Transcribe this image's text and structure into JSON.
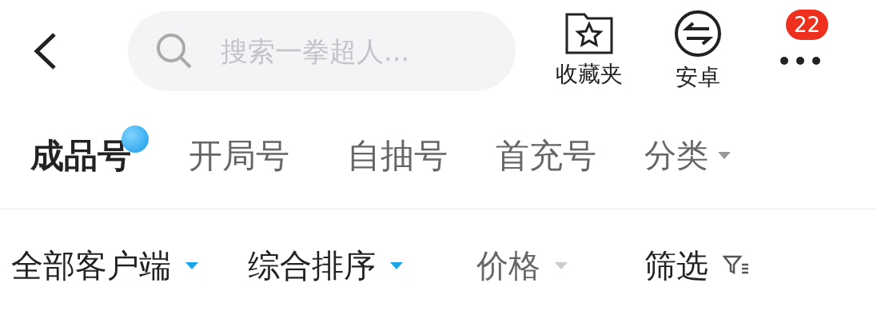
{
  "search": {
    "placeholder": "搜索一拳超人..."
  },
  "actions": [
    {
      "kind": "favorites",
      "label": "收藏夹"
    },
    {
      "kind": "platform",
      "label": "安卓"
    },
    {
      "kind": "more",
      "badge": "22"
    }
  ],
  "tabs": [
    {
      "label": "成品号",
      "selected": true,
      "dot": true
    },
    {
      "label": "开局号",
      "selected": false,
      "dot": false
    },
    {
      "label": "自抽号",
      "selected": false,
      "dot": false
    },
    {
      "label": "首充号",
      "selected": false,
      "dot": false
    }
  ],
  "category": {
    "label": "分类"
  },
  "filters": [
    {
      "kind": "dropdown",
      "label": "全部客户端",
      "highlighted": true
    },
    {
      "kind": "dropdown",
      "label": "综合排序",
      "highlighted": true
    },
    {
      "kind": "dropdown",
      "label": "价格",
      "highlighted": false
    },
    {
      "kind": "filter",
      "label": "筛选"
    }
  ]
}
